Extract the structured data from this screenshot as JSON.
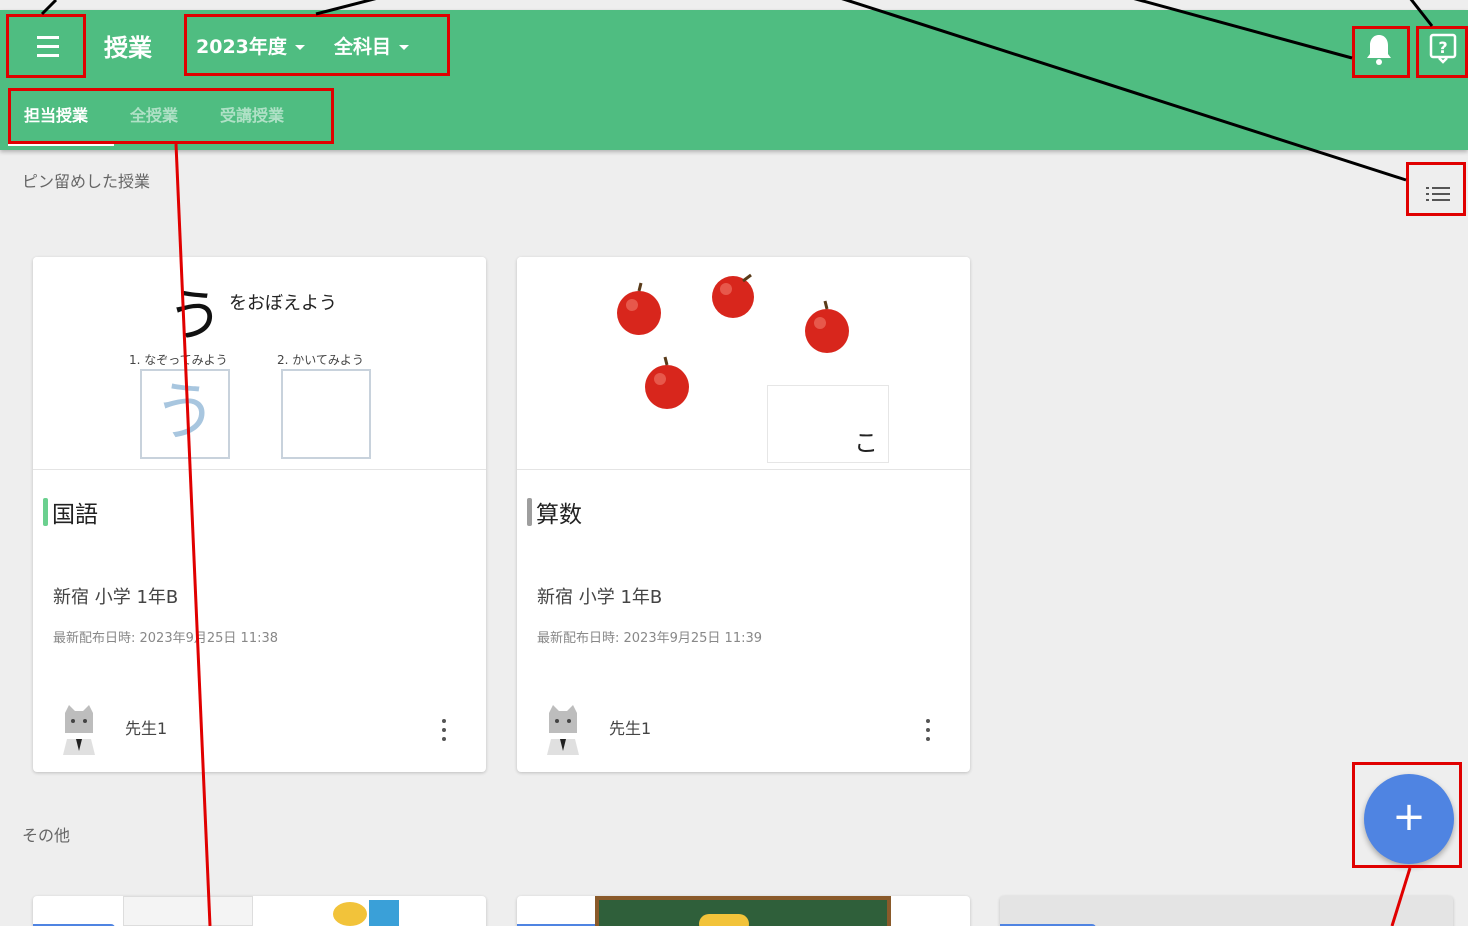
{
  "header": {
    "title": "授業",
    "year_label": "2023年度",
    "subject_label": "全科目",
    "icons": [
      "menu-icon",
      "bell-icon",
      "help-icon"
    ]
  },
  "tabs": [
    {
      "label": "担当授業",
      "active": true
    },
    {
      "label": "全授業",
      "active": false
    },
    {
      "label": "受講授業",
      "active": false
    }
  ],
  "sections": {
    "pinned_title": "ピン留めした授業",
    "other_title": "その他"
  },
  "cards": [
    {
      "subject": "国語",
      "accent": "#6bd08f",
      "class_name": "新宿 小学 1年B",
      "distributed": "最新配布日時: 2023年9月25日 11:38",
      "teacher": "先生1",
      "thumb": {
        "char": "う",
        "caption": "をおぼえよう",
        "step1": "1. なぞってみよう",
        "step2": "2. かいてみよう"
      }
    },
    {
      "subject": "算数",
      "accent": "#9e9e9e",
      "class_name": "新宿 小学 1年B",
      "distributed": "最新配布日時: 2023年9月25日 11:39",
      "teacher": "先生1",
      "thumb": {
        "char": "こ"
      }
    }
  ],
  "fab": {
    "symbol": "+"
  },
  "colors": {
    "header": "#4fbd81",
    "fab": "#4f84e2",
    "annotation": "#e00000"
  }
}
